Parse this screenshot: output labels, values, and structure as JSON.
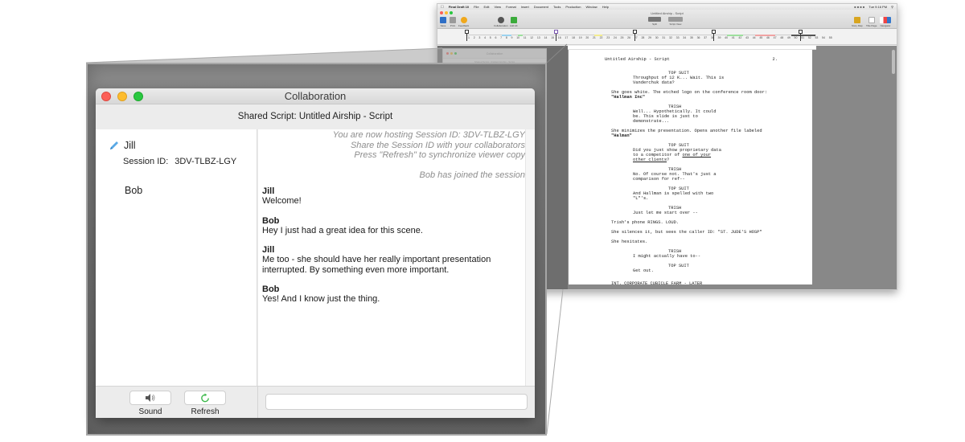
{
  "background_app": {
    "menubar": {
      "app_name": "Final Draft 10",
      "items": [
        "File",
        "Edit",
        "View",
        "Format",
        "Insert",
        "Document",
        "Tools",
        "Production",
        "Window",
        "Help"
      ],
      "clock": "Tue 9:16 PM"
    },
    "window_title": "Untitled Airship - Script",
    "toolbar_left": [
      "Save",
      "Print",
      "Feedback"
    ],
    "toolbar_mid": [
      "Collaboration",
      "Add Alt"
    ],
    "toolbar_view": [
      "Split",
      "Script View"
    ],
    "toolbar_right": [
      "Story Map",
      "Title Page",
      "Navigator"
    ],
    "ruler_numbers": [
      "1",
      "2",
      "3",
      "4",
      "5",
      "6",
      "7",
      "8",
      "9",
      "10",
      "11",
      "12",
      "13",
      "14",
      "15",
      "16",
      "17",
      "18",
      "19",
      "20",
      "21",
      "22",
      "23",
      "24",
      "25",
      "26",
      "27",
      "28",
      "29",
      "30",
      "31",
      "32",
      "33",
      "34",
      "35",
      "36",
      "37",
      "38",
      "39",
      "40",
      "41",
      "42",
      "43",
      "44",
      "45",
      "46",
      "47",
      "48",
      "49",
      "50",
      "51",
      "52",
      "53",
      "54",
      "55"
    ],
    "page": {
      "header_title": "Untitled Airship - Script",
      "page_number": "2.",
      "elements": [
        {
          "type": "character",
          "text": "TOP SUIT"
        },
        {
          "type": "dialogue",
          "text": "Throughput of 12 K... Wait. This is\nVanderchuk data?"
        },
        {
          "type": "action",
          "text": "She goes white. The etched logo on the conference room door:",
          "bold_tail": "\"Hallman Inc\""
        },
        {
          "type": "character",
          "text": "TRISH"
        },
        {
          "type": "dialogue",
          "text": "Well... Hypothetically. It could\nbe. This slide is just to\ndemonstrate..."
        },
        {
          "type": "action",
          "text": "She minimizes the presentation. Opens another file labeled",
          "bold_tail": "\"Halman\""
        },
        {
          "type": "character",
          "text": "TOP SUIT"
        },
        {
          "type": "dialogue",
          "text": "Did you just show proprietary data\nto a competitor of ",
          "underlined": "one of your\nother clients",
          "after": "?"
        },
        {
          "type": "character",
          "text": "TRISH"
        },
        {
          "type": "dialogue",
          "text": "No. Of course not. That's just a\ncomparison for ref--"
        },
        {
          "type": "character",
          "text": "TOP SUIT"
        },
        {
          "type": "dialogue",
          "text": "And Hallman is spelled with two\n\"L\"'s."
        },
        {
          "type": "character",
          "text": "TRISH"
        },
        {
          "type": "dialogue",
          "text": "Just let me start over --"
        },
        {
          "type": "action",
          "text": "Trish's phone RINGS. LOUD."
        },
        {
          "type": "action",
          "text": "She silences it, but sees the caller ID: \"ST. JUDE'S HOSP\""
        },
        {
          "type": "action",
          "text": "She hesitates."
        },
        {
          "type": "character",
          "text": "TRISH"
        },
        {
          "type": "dialogue",
          "text": "I might actually have to--"
        },
        {
          "type": "character",
          "text": "TOP SUIT"
        },
        {
          "type": "dialogue",
          "text": "Get out."
        },
        {
          "type": "scene",
          "text": "INT. CORPORATE CUBICLE FARM - LATER"
        }
      ]
    }
  },
  "collab": {
    "window_title": "Collaboration",
    "shared_script": "Shared Script: Untitled Airship - Script",
    "users": [
      {
        "name": "Jill",
        "icon": "pencil-icon",
        "session_label": "Session ID:",
        "session_id": "3DV-TLBZ-LGY"
      },
      {
        "name": "Bob"
      }
    ],
    "system_messages": [
      "You are now hosting Session ID: 3DV-TLBZ-LGY",
      "Share the Session ID with your collaborators",
      "Press \"Refresh\" to synchronize viewer copy",
      "Bob has joined the session"
    ],
    "messages": [
      {
        "from": "Jill",
        "text": "Welcome!"
      },
      {
        "from": "Bob",
        "text": "Hey I just had a great idea for this scene."
      },
      {
        "from": "Jill",
        "text": "Me too - she should have her really important presentation interrupted. By something even more important."
      },
      {
        "from": "Bob",
        "text": "Yes! And I know just the thing."
      }
    ],
    "buttons": {
      "sound": {
        "label": "Sound",
        "icon": "speaker-icon"
      },
      "refresh": {
        "label": "Refresh",
        "icon": "refresh-icon"
      }
    },
    "chat_input": {
      "value": "",
      "placeholder": ""
    }
  },
  "colors": {
    "close": "#fc5f57",
    "minimize": "#fdbc2e",
    "maximize": "#29c840",
    "pencil": "#5aa9e6",
    "refresh": "#3cb94a",
    "system_text": "#8e8e8e"
  }
}
